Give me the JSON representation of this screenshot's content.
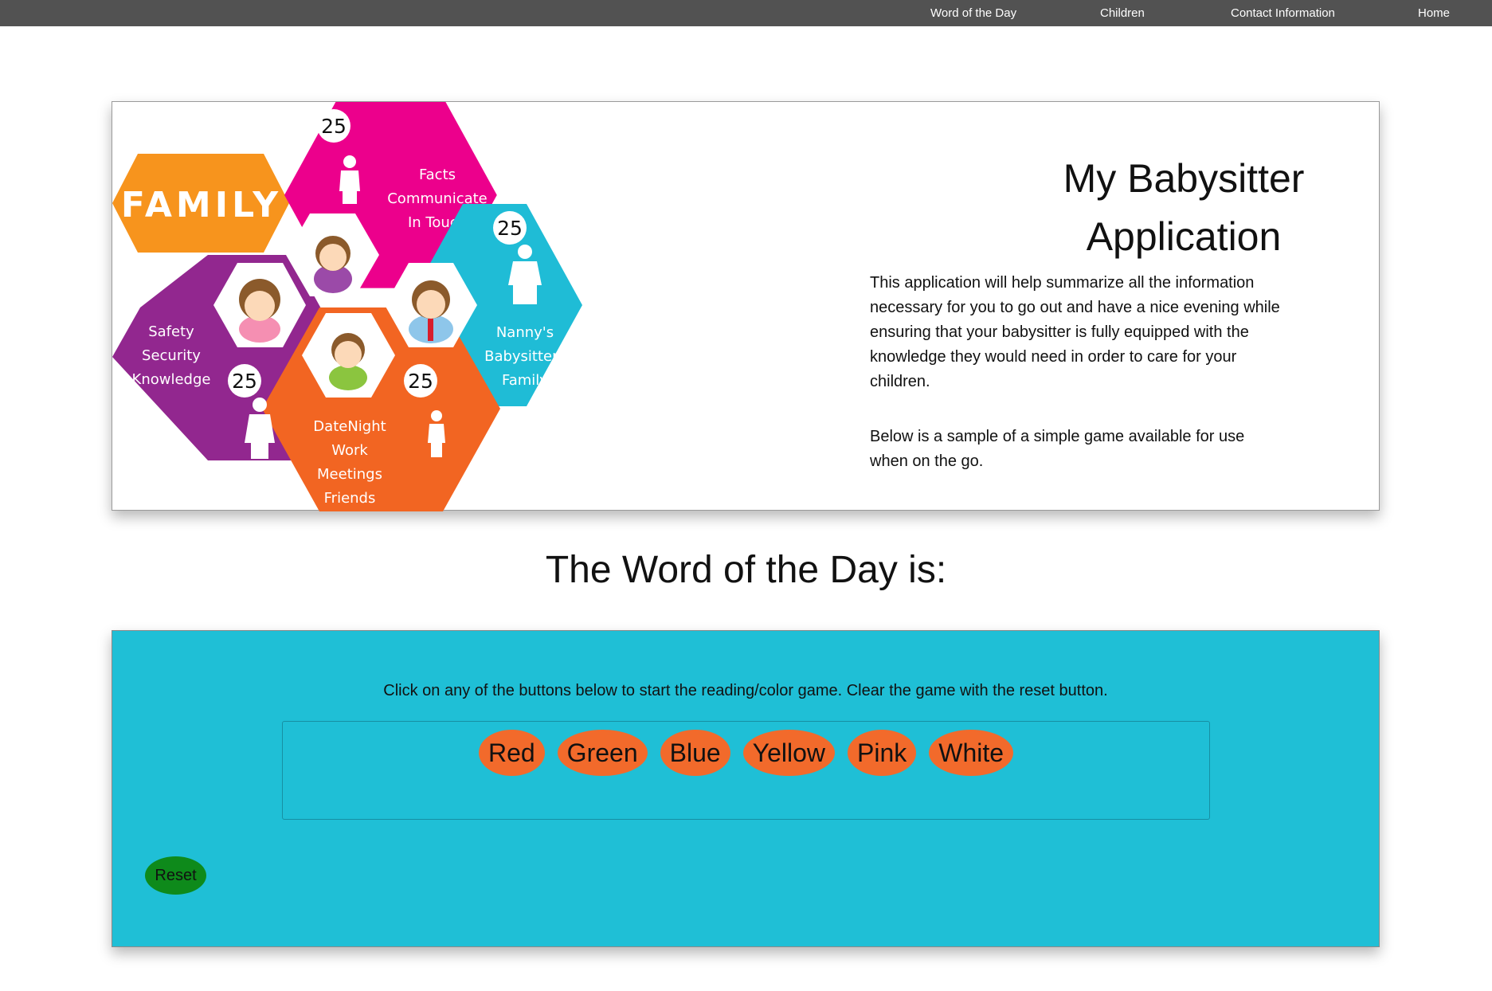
{
  "nav": {
    "items": [
      {
        "label": "Word of the Day"
      },
      {
        "label": "Children"
      },
      {
        "label": "Contact Information"
      },
      {
        "label": "Home"
      }
    ]
  },
  "hero": {
    "graphic": {
      "family_label": "FAMILY",
      "facts_lines": [
        "Facts",
        "Communicate",
        "In Touch"
      ],
      "nanny_lines": [
        "Nanny's",
        "Babysitters",
        "Family"
      ],
      "safety_lines": [
        "Safety",
        "Security",
        "Knowledge"
      ],
      "datenight_lines": [
        "DateNight",
        "Work",
        "Meetings",
        "Friends"
      ],
      "badges": [
        "25",
        "25",
        "25",
        "25"
      ]
    },
    "title_line1": "My Babysitter",
    "title_line2": "Application",
    "description": "This application will help summarize all the information necessary for you to go out and have a nice evening while ensuring that your babysitter is fully equipped with the knowledge they would need in order to care for your children.",
    "description2": "Below is a sample of a simple game available for use when on the go."
  },
  "word_of_day": {
    "heading": "The Word of the Day is:"
  },
  "game": {
    "instructions": "Click on any of the buttons below to start the reading/color game. Clear the game with the reset button.",
    "color_buttons": [
      "Red",
      "Green",
      "Blue",
      "Yellow",
      "Pink",
      "White"
    ],
    "reset_label": "Reset"
  },
  "colors": {
    "nav_bg": "#525252",
    "game_bg": "#1fbfd6",
    "color_button_bg": "#f26a2b",
    "reset_button_bg": "#0e8a1b",
    "hex_orange": "#f7941d",
    "hex_magenta": "#ec008c",
    "hex_cyan": "#1fbcd6",
    "hex_purple": "#92278f",
    "hex_orange_red": "#f26522"
  }
}
